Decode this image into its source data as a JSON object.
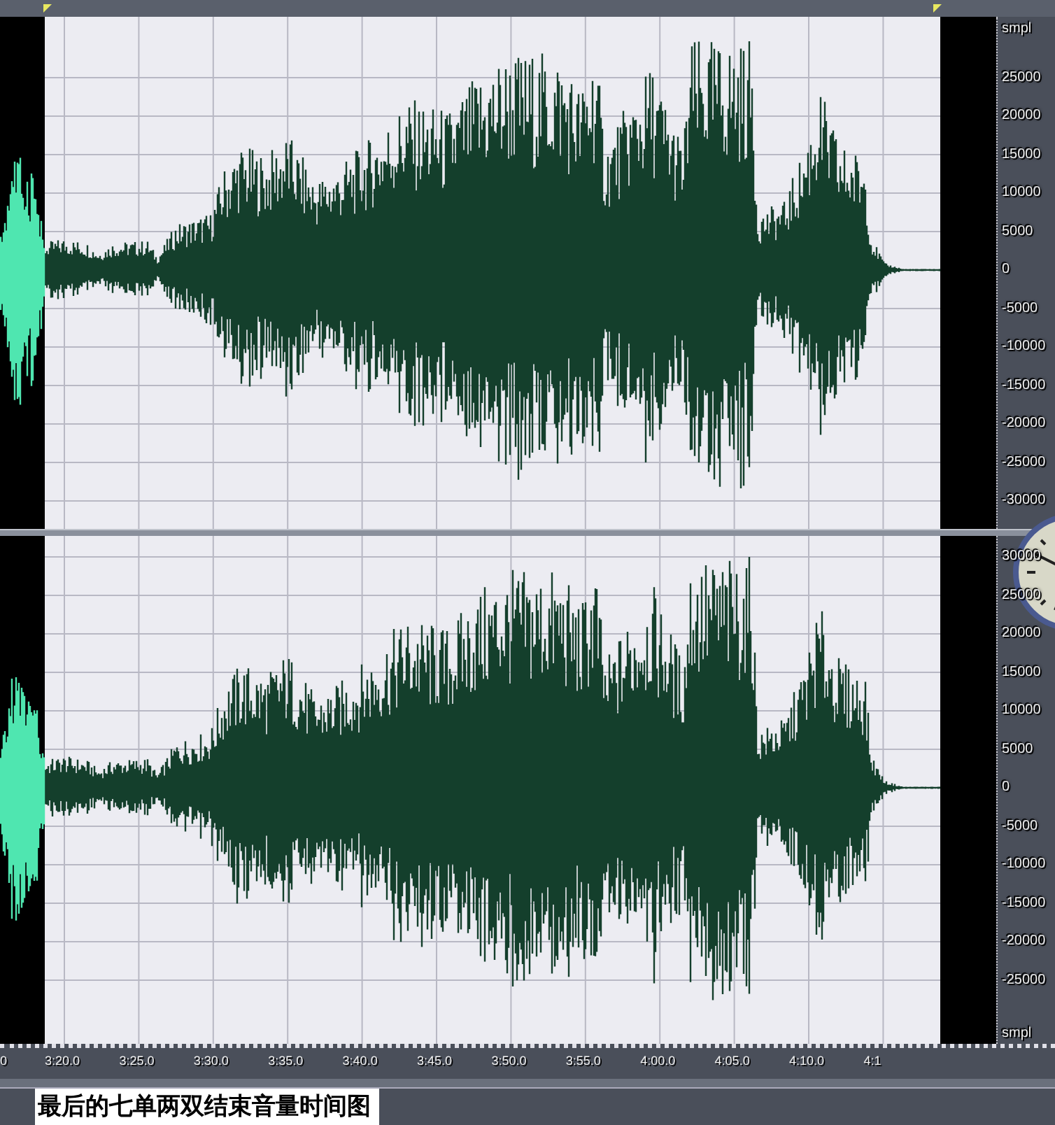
{
  "tracks": [
    {
      "unit_label": "smpl",
      "axis_labels": [
        "25000",
        "20000",
        "15000",
        "10000",
        "5000",
        "0",
        "-5000",
        "-10000",
        "-15000",
        "-20000",
        "-25000",
        "-30000"
      ]
    },
    {
      "unit_label": "smpl",
      "axis_labels": [
        "30000",
        "25000",
        "20000",
        "15000",
        "10000",
        "5000",
        "0",
        "-5000",
        "-10000",
        "-15000",
        "-20000",
        "-25000"
      ]
    }
  ],
  "timeline": {
    "leading_label": "0",
    "labels": [
      "3:20.0",
      "3:25.0",
      "3:30.0",
      "3:35.0",
      "3:40.0",
      "3:45.0",
      "3:50.0",
      "3:55.0",
      "4:00.0",
      "4:05.0",
      "4:10.0",
      "4:1"
    ]
  },
  "caption": "最后的七单两双结束音量时间图"
}
